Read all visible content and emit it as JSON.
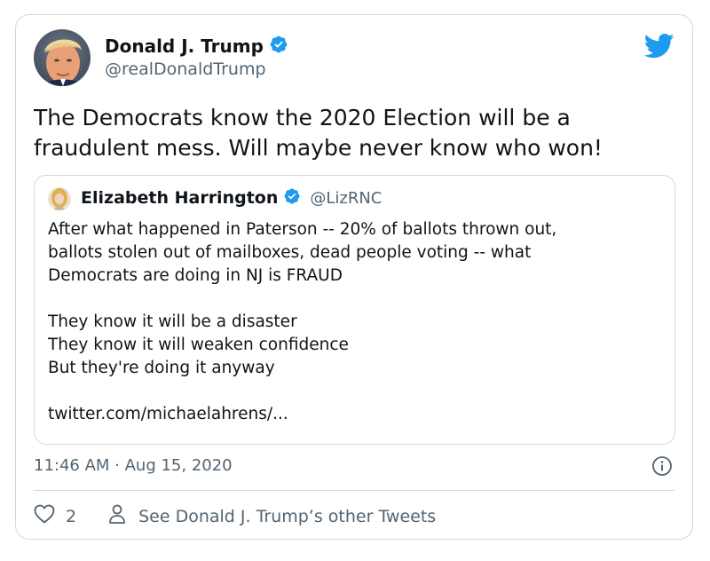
{
  "tweet": {
    "author_name": "Donald J. Trump",
    "author_handle": "@realDonaldTrump",
    "text_lines": [
      "The Democrats know the 2020 Election will be a",
      "fraudulent mess. Will maybe never know who won!"
    ],
    "timestamp": "11:46 AM · Aug 15, 2020",
    "like_count": "2",
    "see_more_label": "See Donald J. Trump’s other Tweets"
  },
  "quote": {
    "author_name": "Elizabeth Harrington",
    "author_handle": "@LizRNC",
    "lines": [
      "After what happened in Paterson -- 20% of ballots thrown out,",
      "ballots stolen out of mailboxes, dead people voting -- what",
      "Democrats are doing in NJ is FRAUD",
      "",
      "They know it will be a disaster",
      "They know it will weaken confidence",
      "But they're doing it anyway",
      "",
      "twitter.com/michaelahrens/..."
    ]
  },
  "colors": {
    "brand": "#1d9bf0",
    "text": "#0f1419",
    "secondary": "#536471",
    "border": "#cfd9de"
  },
  "icons": {
    "logo": "twitter-bird-icon",
    "verified": "verified-badge-icon",
    "info": "info-icon",
    "like": "heart-icon",
    "profile": "person-icon"
  }
}
